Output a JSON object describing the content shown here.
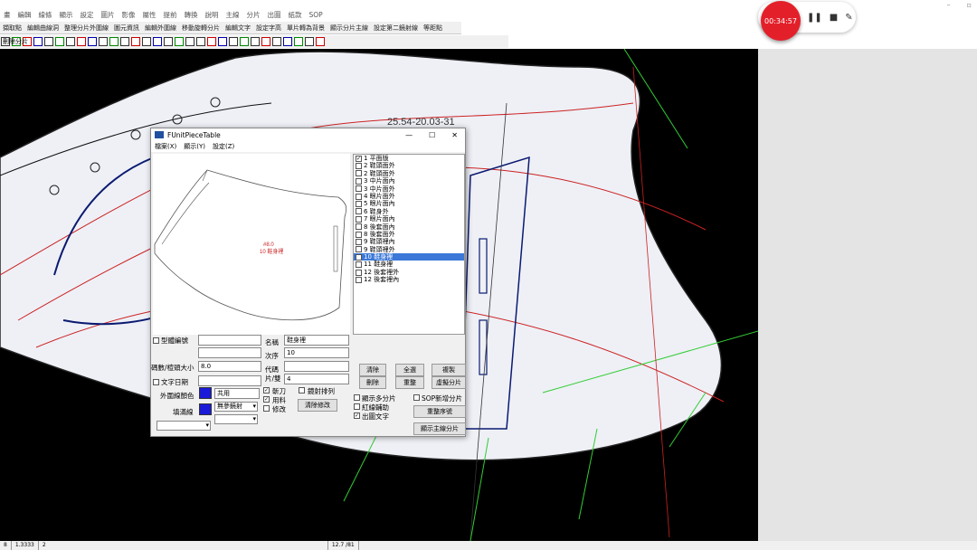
{
  "menu": [
    "畫",
    "編輯",
    "線條",
    "顯示",
    "設定",
    "圖片",
    "影像",
    "屬性",
    "提前",
    "轉換",
    "說明",
    "主線",
    "分片",
    "出圖",
    "紙款",
    "SOP"
  ],
  "toolbar1": [
    "擷取點",
    "編輯曲線洞",
    "整理分片外圍線",
    "圖元資訊",
    "編輯外圍線",
    "移動旋轉分片",
    "編輯文字",
    "設定字高",
    "單片轉為背景",
    "顯示分片主線",
    "設定第二鏡射線",
    "等距點"
  ],
  "toolbar2": {
    "delete_piece": "刪除分片"
  },
  "recorder": {
    "time": "00:34:57",
    "pause": "❚❚",
    "stop": "■",
    "pen": "✎"
  },
  "window_controls": [
    "–",
    "▫"
  ],
  "canvas": {
    "date_text": "25.54-20.03-31"
  },
  "dialog": {
    "title": "FUnitPieceTable",
    "controls": [
      "—",
      "☐",
      "✕"
    ],
    "menu": [
      "檔案(X)",
      "顯示(Y)",
      "設定(Z)"
    ],
    "preview_label_line1": "#8.0",
    "preview_label_line2": "10 鞋身裡",
    "pieces": [
      {
        "label": "1 平面版",
        "checked": true,
        "selected": false
      },
      {
        "label": "2 鞋頭面外",
        "checked": false,
        "selected": false
      },
      {
        "label": "2 鞋頭面外",
        "checked": false,
        "selected": false
      },
      {
        "label": "3 中片面內",
        "checked": false,
        "selected": false
      },
      {
        "label": "3 中片面外",
        "checked": false,
        "selected": false
      },
      {
        "label": "4 眼片面外",
        "checked": false,
        "selected": false
      },
      {
        "label": "5 眼片面內",
        "checked": false,
        "selected": false
      },
      {
        "label": "6 鞋身外",
        "checked": false,
        "selected": false
      },
      {
        "label": "7 眼片面內",
        "checked": false,
        "selected": false
      },
      {
        "label": "8 後套面內",
        "checked": false,
        "selected": false
      },
      {
        "label": "8 後套面外",
        "checked": false,
        "selected": false
      },
      {
        "label": "9 鞋頭裡內",
        "checked": false,
        "selected": false
      },
      {
        "label": "9 鞋頭裡外",
        "checked": false,
        "selected": false
      },
      {
        "label": "10 鞋身裡",
        "checked": true,
        "selected": true
      },
      {
        "label": "11 鞋身裡",
        "checked": false,
        "selected": false
      },
      {
        "label": "12 後套裡外",
        "checked": false,
        "selected": false
      },
      {
        "label": "12 後套裡內",
        "checked": false,
        "selected": false
      }
    ],
    "form": {
      "model_no_label": "型體編號",
      "size_label": "碼數/楦頭大小",
      "size_value": "8.0",
      "text_date_label": "文字日期",
      "outer_color_label": "外圍線顏色",
      "fill_label": "填滿線",
      "name_label": "名稱",
      "name_value": "鞋身裡",
      "order_label": "次序",
      "order_value": "10",
      "code_label": "代碼",
      "pairs_label": "片/雙",
      "pairs_value": "4",
      "share_value": "共用",
      "mirror_value": "無參鏡射",
      "knife_label": "斬刀",
      "material_label": "用料",
      "modify_label": "修改",
      "mirror_arrange_label": "鏡射排列",
      "clear_modify_label": "清除修改",
      "btn_clear": "清除",
      "btn_select_all": "全選",
      "btn_copy": "複製",
      "btn_delete": "刪除",
      "btn_reset": "重整",
      "btn_virtual": "虛擬分片",
      "show_multi_label": "顯示多分片",
      "sop_new_label": "SOP新增分片",
      "red_aux_label": "紅線輔助",
      "output_text_label": "出圖文字",
      "btn_reorder": "重整序號",
      "btn_show_main": "顯示主線分片"
    }
  },
  "status": [
    "8",
    "1.3333",
    "2",
    "12.7 /81"
  ]
}
